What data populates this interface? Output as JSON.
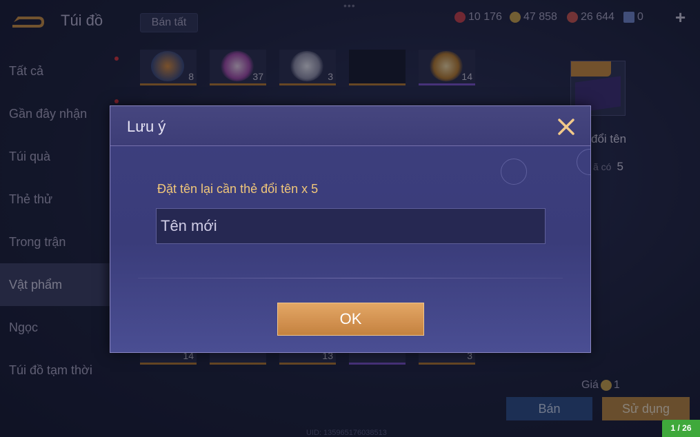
{
  "topbar": {
    "title": "Túi đồ",
    "sell_all_label": "Bán tất",
    "dots": "•••",
    "currencies": [
      {
        "icon": "red-gem-icon",
        "value": "10 176",
        "color": "#c7404a"
      },
      {
        "icon": "gold-coin-icon",
        "value": "47 858",
        "color": "#c9a24a"
      },
      {
        "icon": "ruby-icon",
        "value": "26 644",
        "color": "#c9554f"
      },
      {
        "icon": "blue-card-icon",
        "value": "0",
        "color": "#6f86c8"
      }
    ],
    "plus_label": "+"
  },
  "sidebar": {
    "items": [
      {
        "label": "Tất cả",
        "active": false,
        "dot": true
      },
      {
        "label": "Gần đây nhận",
        "active": false,
        "dot": true
      },
      {
        "label": "Túi quà",
        "active": false,
        "dot": false
      },
      {
        "label": "Thẻ thử",
        "active": false,
        "dot": false
      },
      {
        "label": "Trong trận",
        "active": false,
        "dot": false
      },
      {
        "label": "Vật phẩm",
        "active": true,
        "dot": false
      },
      {
        "label": "Ngọc",
        "active": false,
        "dot": false
      },
      {
        "label": "Túi đồ tạm thời",
        "active": false,
        "dot": false
      }
    ]
  },
  "grid": {
    "top_row": [
      {
        "count": "8"
      },
      {
        "count": "37"
      },
      {
        "count": "3"
      },
      {
        "count": ""
      },
      {
        "count": "14"
      }
    ],
    "bottom_row": [
      {
        "count": "14"
      },
      {
        "count": ""
      },
      {
        "count": "13"
      },
      {
        "count": ""
      },
      {
        "count": "3"
      }
    ]
  },
  "right_panel": {
    "item_name": "đổi tên",
    "owned_label": "ã có",
    "owned_value": "5",
    "price_label": "Giá",
    "price_value": "1",
    "sell_label": "Bán",
    "use_label": "Sử dụng"
  },
  "uid": "UID: 1359651760385​13",
  "page_badge": "1 / 26",
  "dialog": {
    "title": "Lưu ý",
    "prompt": "Đặt tên lại cần thẻ đổi tên x 5",
    "input_placeholder": "Tên mới",
    "ok_label": "OK"
  }
}
